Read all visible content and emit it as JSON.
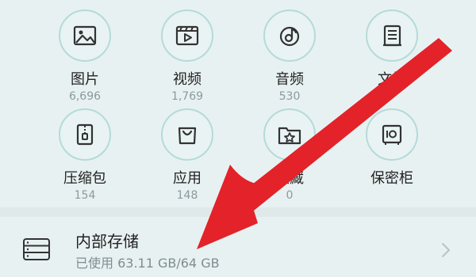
{
  "categories": [
    {
      "label": "图片",
      "count": "6,696",
      "icon": "image-icon"
    },
    {
      "label": "视频",
      "count": "1,769",
      "icon": "video-icon"
    },
    {
      "label": "音频",
      "count": "530",
      "icon": "audio-icon"
    },
    {
      "label": "文档",
      "count": "",
      "icon": "document-icon"
    },
    {
      "label": "压缩包",
      "count": "154",
      "icon": "archive-icon"
    },
    {
      "label": "应用",
      "count": "148",
      "icon": "app-bag-icon"
    },
    {
      "label": "收藏",
      "count": "0",
      "icon": "star-folder-icon"
    },
    {
      "label": "保密柜",
      "count": "",
      "icon": "safe-icon"
    }
  ],
  "storage": {
    "title": "内部存储",
    "usage": "已使用 63.11 GB/64 GB",
    "icon": "storage-icon"
  },
  "colors": {
    "background": "#e8f1f1",
    "icon_ring": "#b4dbd9",
    "arrow": "#e3222a"
  }
}
